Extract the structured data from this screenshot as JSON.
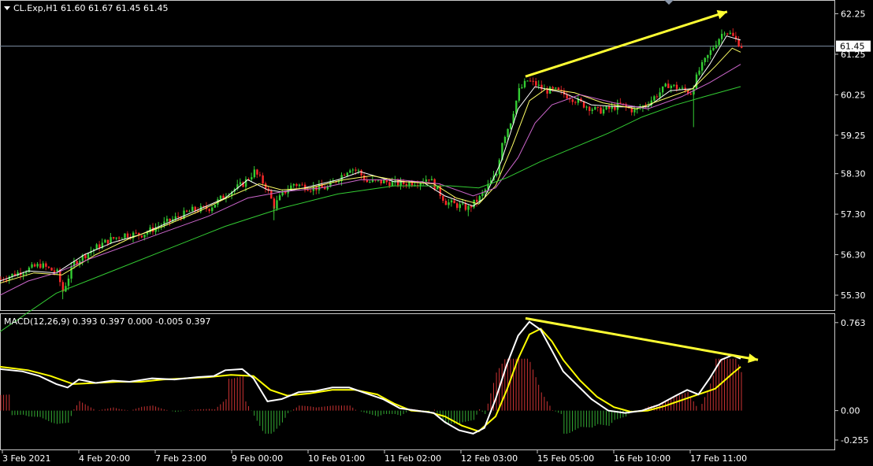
{
  "chart_data": [
    {
      "type": "candlestick",
      "title": "CL.Exp,H1  61.60 61.67 61.45 61.45",
      "symbol_menu_icon": "triangle-down-icon",
      "last_price_label": "61.45",
      "last_price": 61.45,
      "ylim": [
        54.95,
        62.55
      ],
      "y_ticks": [
        "62.25",
        "61.25",
        "60.25",
        "59.25",
        "58.30",
        "57.30",
        "56.30",
        "55.30"
      ],
      "x_tick_labels": [
        "3 Feb 2021",
        "4 Feb 20:00",
        "7 Feb 23:00",
        "9 Feb 00:00",
        "10 Feb 01:00",
        "11 Feb 02:00",
        "12 Feb 03:00",
        "15 Feb 05:00",
        "16 Feb 10:00",
        "17 Feb 11:00"
      ],
      "close_path": [
        [
          0,
          55.7
        ],
        [
          8,
          55.9
        ],
        [
          14,
          56.05
        ],
        [
          17,
          55.95
        ],
        [
          20,
          55.85
        ],
        [
          22,
          55.4
        ],
        [
          26,
          56.1
        ],
        [
          32,
          56.4
        ],
        [
          38,
          56.65
        ],
        [
          44,
          56.8
        ],
        [
          50,
          56.8
        ],
        [
          56,
          57.0
        ],
        [
          62,
          57.2
        ],
        [
          68,
          57.4
        ],
        [
          74,
          57.45
        ],
        [
          80,
          57.8
        ],
        [
          86,
          58.05
        ],
        [
          90,
          58.35
        ],
        [
          94,
          58.0
        ],
        [
          97,
          57.5
        ],
        [
          100,
          57.8
        ],
        [
          104,
          58.05
        ],
        [
          110,
          57.95
        ],
        [
          116,
          57.95
        ],
        [
          120,
          58.2
        ],
        [
          124,
          58.45
        ],
        [
          127,
          58.35
        ],
        [
          130,
          58.1
        ],
        [
          136,
          58.1
        ],
        [
          142,
          58.05
        ],
        [
          148,
          58.1
        ],
        [
          152,
          58.2
        ],
        [
          155,
          57.9
        ],
        [
          158,
          57.6
        ],
        [
          163,
          57.5
        ],
        [
          166,
          57.45
        ],
        [
          170,
          57.7
        ],
        [
          176,
          58.3
        ],
        [
          178,
          59.1
        ],
        [
          181,
          59.6
        ],
        [
          184,
          60.35
        ],
        [
          187,
          60.6
        ],
        [
          190,
          60.5
        ],
        [
          193,
          60.35
        ],
        [
          197,
          60.35
        ],
        [
          202,
          60.2
        ],
        [
          207,
          60.0
        ],
        [
          212,
          59.85
        ],
        [
          216,
          59.9
        ],
        [
          220,
          60.0
        ],
        [
          225,
          59.85
        ],
        [
          229,
          60.0
        ],
        [
          233,
          60.25
        ],
        [
          237,
          60.5
        ],
        [
          241,
          60.4
        ],
        [
          245,
          60.3
        ],
        [
          248,
          60.85
        ],
        [
          251,
          61.2
        ],
        [
          254,
          61.55
        ],
        [
          257,
          61.85
        ],
        [
          259,
          61.75
        ],
        [
          261,
          61.6
        ],
        [
          263,
          61.45
        ]
      ],
      "ma_series": [
        {
          "color": "#ffffff",
          "points": [
            [
              0,
              55.65
            ],
            [
              10,
              55.9
            ],
            [
              20,
              55.85
            ],
            [
              30,
              56.3
            ],
            [
              40,
              56.6
            ],
            [
              50,
              56.8
            ],
            [
              60,
              57.1
            ],
            [
              70,
              57.4
            ],
            [
              80,
              57.7
            ],
            [
              88,
              58.15
            ],
            [
              95,
              57.9
            ],
            [
              100,
              57.85
            ],
            [
              108,
              57.95
            ],
            [
              120,
              58.15
            ],
            [
              128,
              58.35
            ],
            [
              140,
              58.1
            ],
            [
              150,
              58.1
            ],
            [
              158,
              57.75
            ],
            [
              168,
              57.5
            ],
            [
              172,
              57.7
            ],
            [
              178,
              58.6
            ],
            [
              184,
              59.9
            ],
            [
              190,
              60.45
            ],
            [
              200,
              60.3
            ],
            [
              210,
              60.0
            ],
            [
              220,
              59.95
            ],
            [
              230,
              59.95
            ],
            [
              238,
              60.35
            ],
            [
              246,
              60.4
            ],
            [
              252,
              61.0
            ],
            [
              258,
              61.7
            ],
            [
              263,
              61.6
            ]
          ]
        },
        {
          "color": "#ffff66",
          "points": [
            [
              0,
              55.6
            ],
            [
              12,
              55.85
            ],
            [
              22,
              55.8
            ],
            [
              34,
              56.3
            ],
            [
              46,
              56.7
            ],
            [
              58,
              57.0
            ],
            [
              70,
              57.35
            ],
            [
              82,
              57.75
            ],
            [
              92,
              58.05
            ],
            [
              100,
              57.9
            ],
            [
              110,
              57.95
            ],
            [
              122,
              58.15
            ],
            [
              132,
              58.25
            ],
            [
              144,
              58.1
            ],
            [
              154,
              58.05
            ],
            [
              162,
              57.7
            ],
            [
              170,
              57.55
            ],
            [
              176,
              58.0
            ],
            [
              182,
              59.0
            ],
            [
              188,
              60.1
            ],
            [
              194,
              60.4
            ],
            [
              204,
              60.3
            ],
            [
              214,
              60.05
            ],
            [
              226,
              59.9
            ],
            [
              236,
              60.15
            ],
            [
              246,
              60.4
            ],
            [
              254,
              60.95
            ],
            [
              260,
              61.4
            ],
            [
              263,
              61.3
            ]
          ]
        },
        {
          "color": "#cc66cc",
          "points": [
            [
              0,
              55.3
            ],
            [
              10,
              55.65
            ],
            [
              20,
              55.85
            ],
            [
              32,
              56.2
            ],
            [
              46,
              56.55
            ],
            [
              60,
              56.9
            ],
            [
              74,
              57.25
            ],
            [
              88,
              57.7
            ],
            [
              100,
              57.85
            ],
            [
              114,
              57.95
            ],
            [
              128,
              58.15
            ],
            [
              142,
              58.15
            ],
            [
              156,
              58.05
            ],
            [
              168,
              57.75
            ],
            [
              176,
              57.95
            ],
            [
              184,
              58.7
            ],
            [
              190,
              59.55
            ],
            [
              196,
              60.0
            ],
            [
              206,
              60.25
            ],
            [
              218,
              60.05
            ],
            [
              230,
              59.9
            ],
            [
              242,
              60.2
            ],
            [
              252,
              60.55
            ],
            [
              263,
              61.0
            ]
          ]
        },
        {
          "color": "#33cc33",
          "points": [
            [
              0,
              54.4
            ],
            [
              20,
              55.35
            ],
            [
              40,
              55.9
            ],
            [
              60,
              56.45
            ],
            [
              80,
              57.0
            ],
            [
              100,
              57.45
            ],
            [
              120,
              57.8
            ],
            [
              140,
              58.0
            ],
            [
              160,
              58.0
            ],
            [
              170,
              57.95
            ],
            [
              180,
              58.2
            ],
            [
              192,
              58.6
            ],
            [
              204,
              58.95
            ],
            [
              216,
              59.3
            ],
            [
              228,
              59.7
            ],
            [
              240,
              60.0
            ],
            [
              250,
              60.2
            ],
            [
              263,
              60.45
            ]
          ]
        }
      ],
      "annotation_arrow": {
        "color": "#ffff33",
        "from": [
          181,
          60.7
        ],
        "to": [
          261,
          62.3
        ]
      },
      "crosshair_price": 61.45
    },
    {
      "type": "macd",
      "title": "MACD(12,26,9) 0.393 0.397 0.000 -0.005 0.397",
      "ylim": [
        -0.33,
        0.83
      ],
      "y_ticks": [
        "0.763",
        "0.00",
        "-0.255"
      ],
      "y_tick_values": [
        0.763,
        0.0,
        -0.255
      ],
      "macd_line": {
        "color": "#ffffff",
        "points": [
          [
            0,
            0.36
          ],
          [
            8,
            0.34
          ],
          [
            14,
            0.3
          ],
          [
            20,
            0.23
          ],
          [
            24,
            0.2
          ],
          [
            28,
            0.27
          ],
          [
            34,
            0.24
          ],
          [
            40,
            0.26
          ],
          [
            46,
            0.25
          ],
          [
            54,
            0.28
          ],
          [
            62,
            0.27
          ],
          [
            70,
            0.29
          ],
          [
            76,
            0.3
          ],
          [
            80,
            0.35
          ],
          [
            86,
            0.36
          ],
          [
            90,
            0.28
          ],
          [
            95,
            0.08
          ],
          [
            100,
            0.1
          ],
          [
            106,
            0.16
          ],
          [
            112,
            0.17
          ],
          [
            118,
            0.2
          ],
          [
            124,
            0.2
          ],
          [
            130,
            0.15
          ],
          [
            136,
            0.1
          ],
          [
            142,
            0.02
          ],
          [
            148,
            0.0
          ],
          [
            154,
            -0.02
          ],
          [
            158,
            -0.1
          ],
          [
            163,
            -0.17
          ],
          [
            168,
            -0.2
          ],
          [
            172,
            -0.15
          ],
          [
            176,
            0.1
          ],
          [
            180,
            0.4
          ],
          [
            184,
            0.65
          ],
          [
            188,
            0.77
          ],
          [
            192,
            0.7
          ],
          [
            196,
            0.52
          ],
          [
            200,
            0.34
          ],
          [
            205,
            0.22
          ],
          [
            210,
            0.1
          ],
          [
            216,
            0.0
          ],
          [
            222,
            -0.02
          ],
          [
            228,
            0.0
          ],
          [
            234,
            0.05
          ],
          [
            240,
            0.13
          ],
          [
            244,
            0.18
          ],
          [
            248,
            0.14
          ],
          [
            252,
            0.28
          ],
          [
            256,
            0.44
          ],
          [
            260,
            0.48
          ],
          [
            263,
            0.45
          ]
        ]
      },
      "signal_line": {
        "color": "#ffff00",
        "points": [
          [
            0,
            0.38
          ],
          [
            10,
            0.35
          ],
          [
            18,
            0.3
          ],
          [
            26,
            0.23
          ],
          [
            34,
            0.24
          ],
          [
            42,
            0.25
          ],
          [
            50,
            0.25
          ],
          [
            58,
            0.27
          ],
          [
            66,
            0.28
          ],
          [
            74,
            0.29
          ],
          [
            82,
            0.31
          ],
          [
            90,
            0.3
          ],
          [
            96,
            0.18
          ],
          [
            102,
            0.13
          ],
          [
            110,
            0.15
          ],
          [
            118,
            0.18
          ],
          [
            126,
            0.18
          ],
          [
            134,
            0.14
          ],
          [
            140,
            0.06
          ],
          [
            146,
            0.0
          ],
          [
            152,
            -0.01
          ],
          [
            158,
            -0.05
          ],
          [
            164,
            -0.13
          ],
          [
            170,
            -0.18
          ],
          [
            176,
            -0.05
          ],
          [
            180,
            0.18
          ],
          [
            184,
            0.45
          ],
          [
            188,
            0.66
          ],
          [
            192,
            0.71
          ],
          [
            196,
            0.6
          ],
          [
            200,
            0.44
          ],
          [
            206,
            0.26
          ],
          [
            212,
            0.12
          ],
          [
            218,
            0.03
          ],
          [
            224,
            -0.01
          ],
          [
            230,
            0.0
          ],
          [
            236,
            0.04
          ],
          [
            242,
            0.09
          ],
          [
            248,
            0.14
          ],
          [
            254,
            0.19
          ],
          [
            260,
            0.32
          ],
          [
            263,
            0.38
          ]
        ]
      },
      "histogram_color_positive": "#cc3333",
      "histogram_color_negative": "#33aa33",
      "annotation_arrow": {
        "color": "#ffff33",
        "from": [
          188,
          0.8
        ],
        "to": [
          263,
          0.44
        ]
      }
    }
  ]
}
